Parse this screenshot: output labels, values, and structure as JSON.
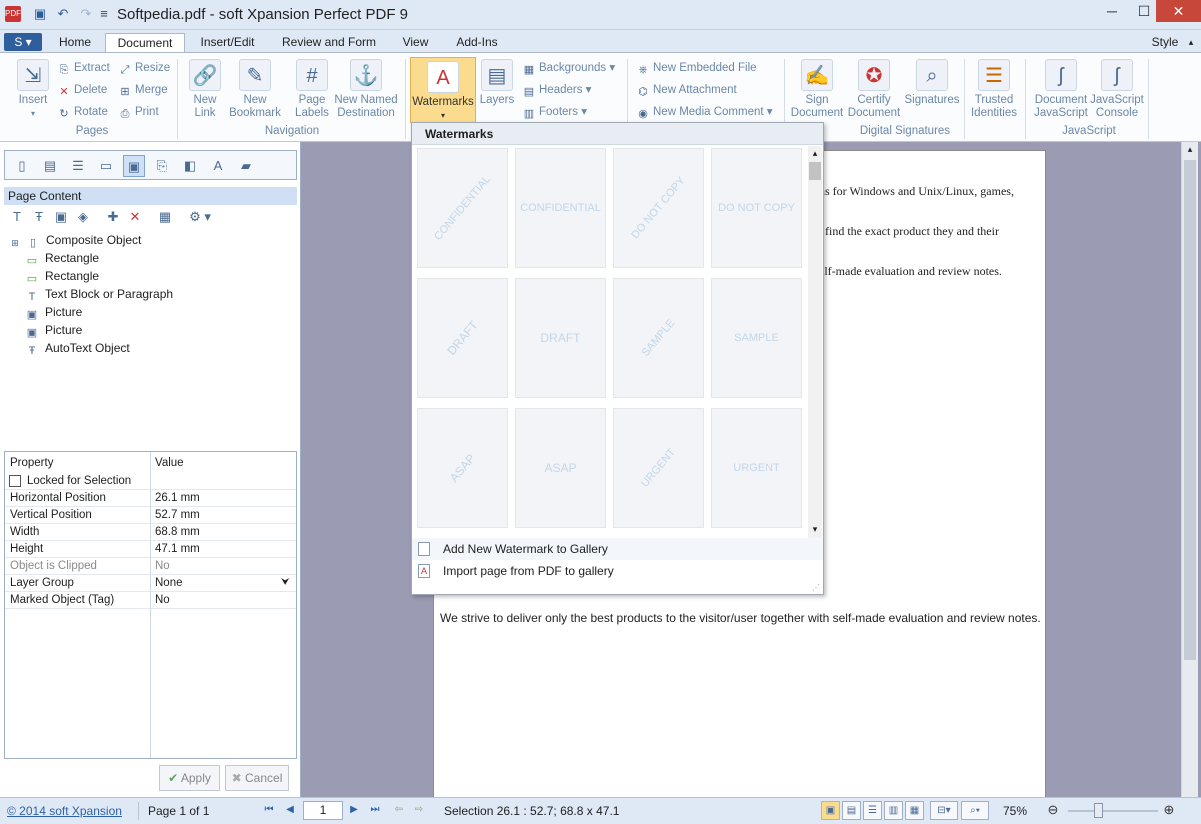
{
  "window": {
    "title": "Softpedia.pdf - soft Xpansion Perfect PDF 9"
  },
  "tabs": [
    "Home",
    "Document",
    "Insert/Edit",
    "Review and Form",
    "View",
    "Add-Ins"
  ],
  "style_menu": "Style",
  "ribbon": {
    "pages": {
      "insert": "Insert",
      "extract": "Extract",
      "delete": "Delete",
      "rotate": "Rotate",
      "resize": "Resize",
      "merge": "Merge",
      "print": "Print",
      "group": "Pages"
    },
    "navigation": {
      "new_link": "New\nLink",
      "new_bookmark": "New\nBookmark",
      "page_labels": "Page\nLabels",
      "new_named_destination": "New Named\nDestination",
      "group": "Navigation"
    },
    "layout": {
      "watermarks": "Watermarks",
      "layers": "Layers",
      "backgrounds": "Backgrounds",
      "headers": "Headers",
      "footers": "Footers"
    },
    "attachments": {
      "embedded_file": "New Embedded File",
      "attachment": "New Attachment",
      "media_comment": "New Media Comment"
    },
    "signatures": {
      "sign": "Sign\nDocument",
      "certify": "Certify\nDocument",
      "signatures": "Signatures",
      "trusted": "Trusted\nIdentities",
      "group": "Digital Signatures"
    },
    "javascript": {
      "document": "Document\nJavaScript",
      "console": "JavaScript\nConsole",
      "group": "JavaScript"
    }
  },
  "page_content": {
    "header": "Page Content",
    "items": [
      "Composite Object",
      "Rectangle",
      "Rectangle",
      "Text Block or Paragraph",
      "Picture",
      "Picture",
      "AutoText Object"
    ]
  },
  "properties": {
    "col_property": "Property",
    "col_value": "Value",
    "locked": "Locked for Selection",
    "rows": [
      {
        "key": "Horizontal Position",
        "value": "26.1 mm"
      },
      {
        "key": "Vertical Position",
        "value": "52.7 mm"
      },
      {
        "key": "Width",
        "value": "68.8 mm"
      },
      {
        "key": "Height",
        "value": "47.1 mm"
      },
      {
        "key": "Object is Clipped",
        "value": "No"
      },
      {
        "key": "Layer Group",
        "value": "None"
      },
      {
        "key": "Marked Object (Tag)",
        "value": "No"
      }
    ],
    "apply": "Apply",
    "cancel": "Cancel"
  },
  "gallery": {
    "header": "Watermarks",
    "thumbs": [
      "CONFIDENTIAL",
      "CONFIDENTIAL",
      "DO NOT COPY",
      "DO NOT COPY",
      "DRAFT",
      "DRAFT",
      "SAMPLE",
      "SAMPLE",
      "ASAP",
      "ASAP",
      "URGENT",
      "URGENT"
    ],
    "add_new": "Add New Watermark to Gallery",
    "import": "Import page from PDF to gallery"
  },
  "document": {
    "line1": "ns for Windows and Unix/Linux, games,",
    "line2": "find the exact product they and their",
    "line3": "elf-made evaluation and review notes.",
    "line4": "We strive to deliver only the best products to the visitor/user together with self-made evaluation and review notes."
  },
  "status": {
    "copyright": "© 2014 soft Xpansion",
    "page": "Page 1 of 1",
    "page_input": "1",
    "selection": "Selection 26.1 : 52.7; 68.8 x 47.1",
    "zoom": "75%"
  }
}
